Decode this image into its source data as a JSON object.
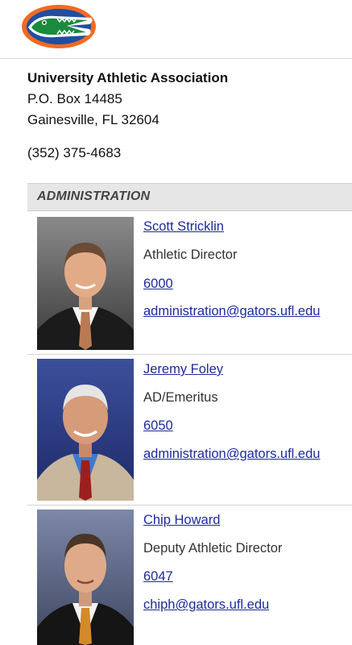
{
  "organization": {
    "name": "University Athletic Association",
    "address_line1": "P.O. Box 14485",
    "address_line2": "Gainesville, FL 32604",
    "phone": "(352) 375-4683"
  },
  "logo": {
    "icon": "gator-head-logo",
    "colors": {
      "orange": "#f26a21",
      "blue": "#1f4ea3",
      "green": "#1a8a3d"
    }
  },
  "section": {
    "title": "ADMINISTRATION"
  },
  "staff": [
    {
      "name": "Scott Stricklin",
      "title": "Athletic Director",
      "extension": "6000",
      "email": "administration@gators.ufl.edu"
    },
    {
      "name": "Jeremy Foley",
      "title": "AD/Emeritus",
      "extension": "6050",
      "email": "administration@gators.ufl.edu"
    },
    {
      "name": "Chip Howard",
      "title": "Deputy Athletic Director",
      "extension": "6047",
      "email": "chiph@gators.ufl.edu"
    }
  ]
}
